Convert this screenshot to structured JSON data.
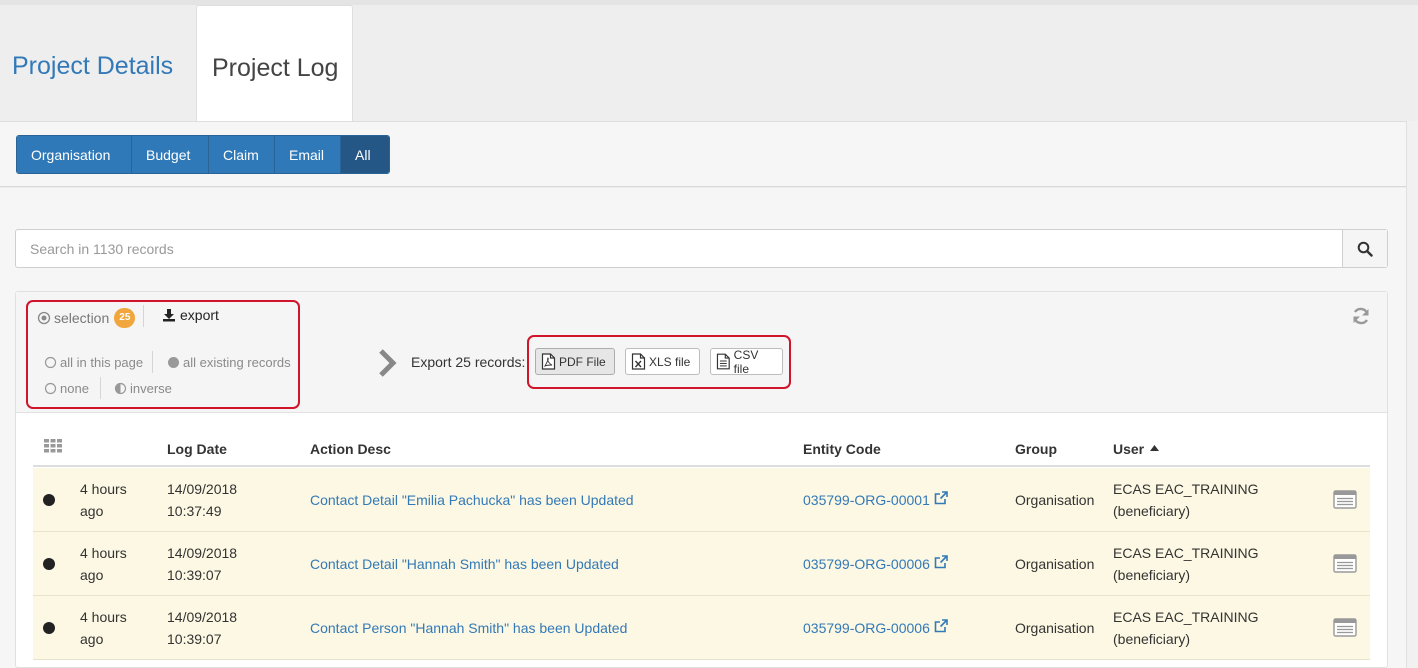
{
  "tabs": {
    "details": "Project Details",
    "log": "Project Log"
  },
  "filters": [
    "Organisation",
    "Budget",
    "Claim",
    "Email",
    "All"
  ],
  "search": {
    "placeholder": "Search in 1130 records"
  },
  "selection": {
    "label": "selection",
    "count": "25",
    "export_label": "export",
    "options": {
      "all_page": "all in this page",
      "all_existing": "all existing records",
      "none": "none",
      "inverse": "inverse"
    }
  },
  "export": {
    "text": "Export 25 records:",
    "pdf": "PDF File",
    "xls": "XLS file",
    "csv": "CSV file"
  },
  "table": {
    "headers": {
      "log_date": "Log Date",
      "action_desc": "Action Desc",
      "entity_code": "Entity Code",
      "group": "Group",
      "user": "User"
    },
    "rows": [
      {
        "ago_1": "4 hours",
        "ago_2": "ago",
        "date": "14/09/2018",
        "time": "10:37:49",
        "action": "Contact Detail \"Emilia Pachucka\" has been Updated",
        "entity": "035799-ORG-00001",
        "group": "Organisation",
        "user_1": "ECAS EAC_TRAINING",
        "user_2": "(beneficiary)"
      },
      {
        "ago_1": "4 hours",
        "ago_2": "ago",
        "date": "14/09/2018",
        "time": "10:39:07",
        "action": "Contact Detail \"Hannah Smith\" has been Updated",
        "entity": "035799-ORG-00006",
        "group": "Organisation",
        "user_1": "ECAS EAC_TRAINING",
        "user_2": "(beneficiary)"
      },
      {
        "ago_1": "4 hours",
        "ago_2": "ago",
        "date": "14/09/2018",
        "time": "10:39:07",
        "action": "Contact Person \"Hannah Smith\" has been Updated",
        "entity": "035799-ORG-00006",
        "group": "Organisation",
        "user_1": "ECAS EAC_TRAINING",
        "user_2": "(beneficiary)"
      }
    ]
  },
  "colors": {
    "primary": "#3079b8",
    "active": "#245686",
    "highlight": "#d0142c",
    "row_bg": "#fcf8e3",
    "badge": "#f0a63c"
  }
}
